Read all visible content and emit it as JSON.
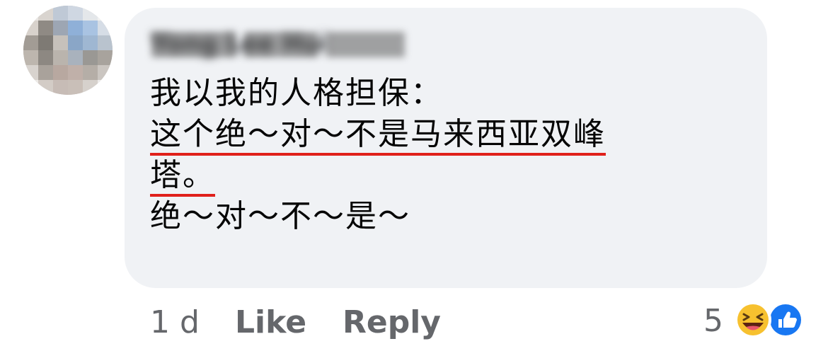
{
  "comment": {
    "author": "Yong Lee Hui",
    "lines": [
      "我以我的人格担保：",
      "这个绝～对～不是马来西亚双峰",
      "塔。",
      "绝～对～不～是～"
    ]
  },
  "actions": {
    "time": "1 d",
    "like_label": "Like",
    "reply_label": "Reply"
  },
  "reactions": {
    "count": "5",
    "icons": [
      "haha-icon",
      "like-icon"
    ]
  },
  "colors": {
    "bubble": "#f0f2f5",
    "underline": "#e0201b",
    "secondary_text": "#65676b",
    "like_blue": "#1877f2"
  }
}
